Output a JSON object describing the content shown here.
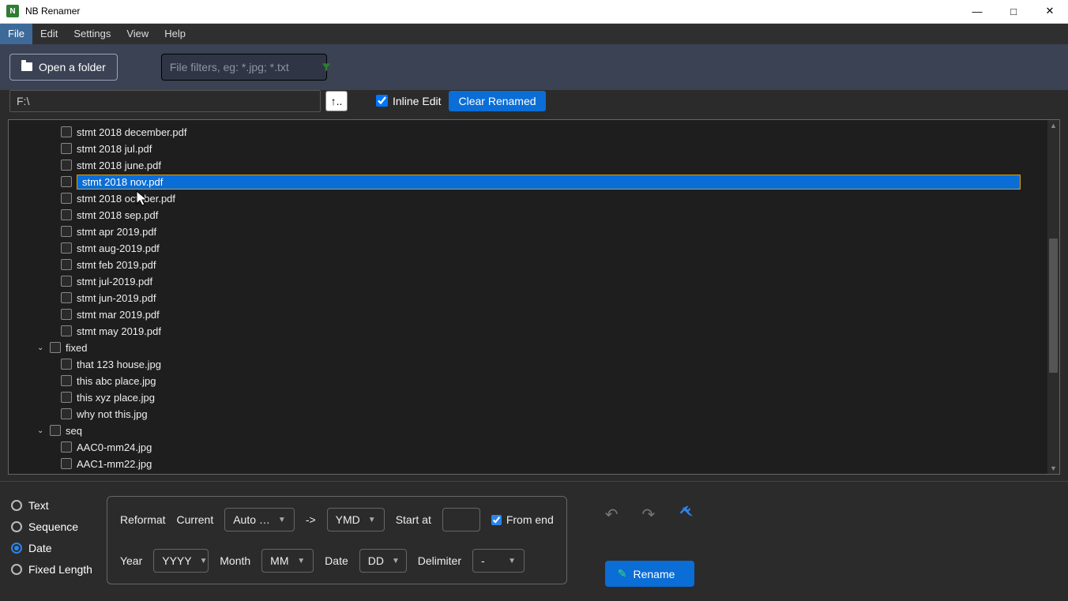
{
  "app": {
    "title": "NB Renamer"
  },
  "menu": [
    "File",
    "Edit",
    "Settings",
    "View",
    "Help"
  ],
  "menu_active_index": 0,
  "toolbar": {
    "open_folder": "Open a folder",
    "filter_placeholder": "File filters, eg: *.jpg; *.txt"
  },
  "path": {
    "value": "F:\\",
    "up_label": "↑.."
  },
  "inline_edit": {
    "label": "Inline Edit",
    "checked": true
  },
  "clear_renamed": "Clear Renamed",
  "tree": {
    "selected_index": 3,
    "items": [
      {
        "type": "file",
        "name": "stmt 2018 december.pdf"
      },
      {
        "type": "file",
        "name": "stmt 2018 jul.pdf"
      },
      {
        "type": "file",
        "name": "stmt 2018 june.pdf"
      },
      {
        "type": "file",
        "name": "stmt 2018 nov.pdf"
      },
      {
        "type": "file",
        "name": "stmt 2018 october.pdf"
      },
      {
        "type": "file",
        "name": "stmt 2018 sep.pdf"
      },
      {
        "type": "file",
        "name": "stmt apr 2019.pdf"
      },
      {
        "type": "file",
        "name": "stmt aug-2019.pdf"
      },
      {
        "type": "file",
        "name": "stmt feb 2019.pdf"
      },
      {
        "type": "file",
        "name": "stmt jul-2019.pdf"
      },
      {
        "type": "file",
        "name": "stmt jun-2019.pdf"
      },
      {
        "type": "file",
        "name": "stmt mar 2019.pdf"
      },
      {
        "type": "file",
        "name": "stmt may 2019.pdf"
      },
      {
        "type": "folder",
        "name": "fixed",
        "expanded": true
      },
      {
        "type": "file",
        "name": "that 123 house.jpg"
      },
      {
        "type": "file",
        "name": "this abc place.jpg"
      },
      {
        "type": "file",
        "name": "this xyz place.jpg"
      },
      {
        "type": "file",
        "name": "why  not this.jpg"
      },
      {
        "type": "folder",
        "name": "seq",
        "expanded": true
      },
      {
        "type": "file",
        "name": "AAC0-mm24.jpg"
      },
      {
        "type": "file",
        "name": "AAC1-mm22.jpg"
      }
    ]
  },
  "modes": {
    "options": [
      "Text",
      "Sequence",
      "Date",
      "Fixed Length"
    ],
    "selected_index": 2
  },
  "date_options": {
    "reformat_label": "Reformat",
    "current_label": "Current",
    "current_value": "Auto …",
    "arrow": "->",
    "target_value": "YMD",
    "start_at_label": "Start at",
    "start_at_value": "",
    "from_end_label": "From end",
    "from_end_checked": true,
    "year_label": "Year",
    "year_value": "YYYY",
    "month_label": "Month",
    "month_value": "MM",
    "date_label": "Date",
    "date_value": "DD",
    "delimiter_label": "Delimiter",
    "delimiter_value": "-"
  },
  "actions": {
    "rename": "Rename"
  }
}
